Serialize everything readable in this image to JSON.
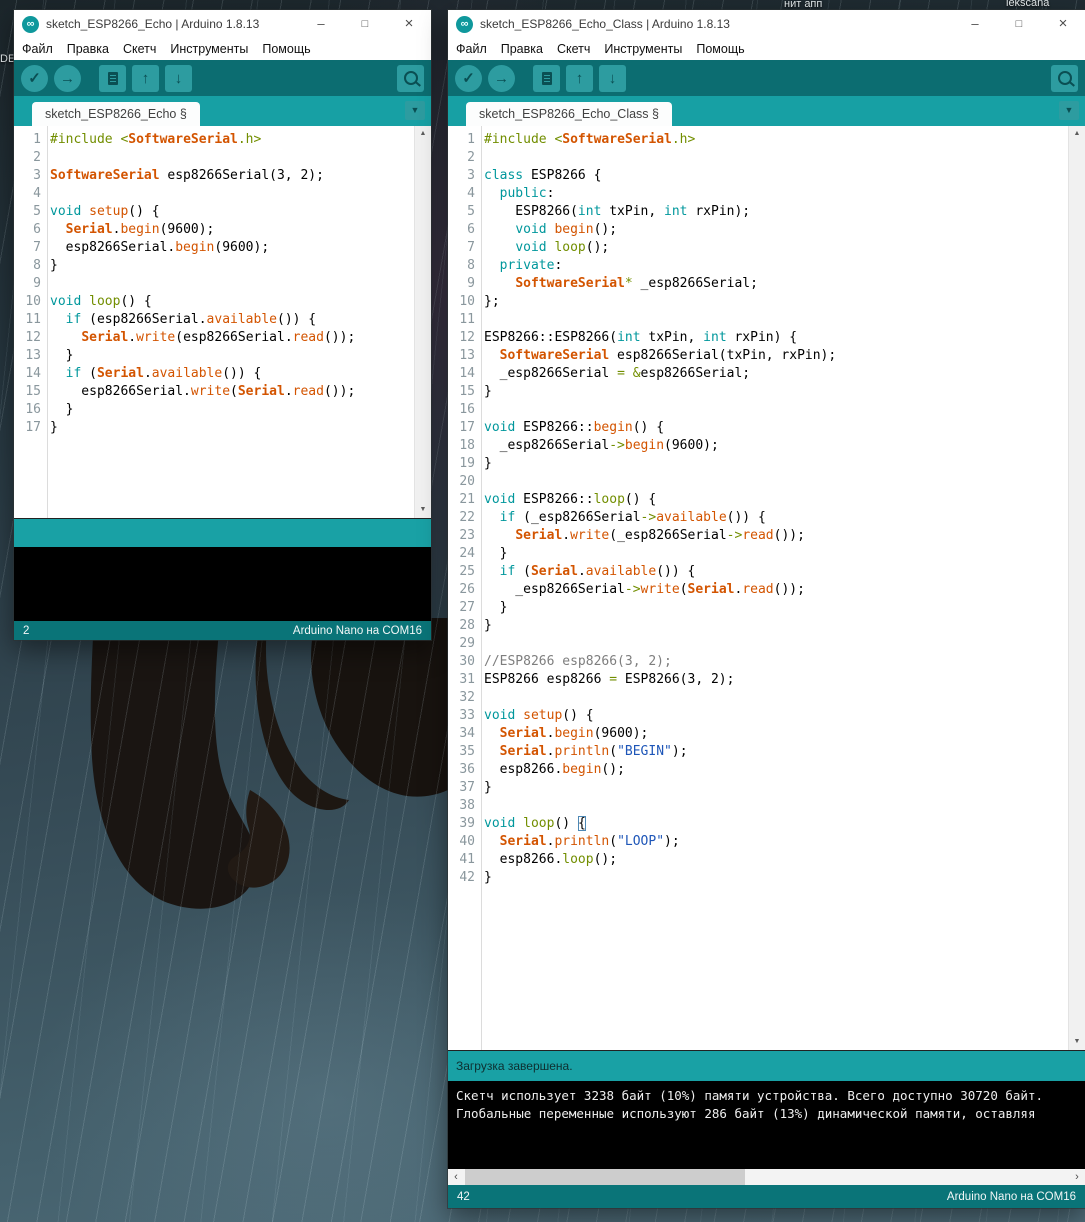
{
  "glyphs": {
    "infinity": "∞",
    "minimize": "–",
    "maximize": "□",
    "close": "×",
    "check": "✓",
    "arrow_right": "→",
    "arrow_up": "↑",
    "arrow_down": "↓",
    "dropdown": "▼",
    "scroll_up": "▲",
    "scroll_down": "▼",
    "scroll_left": "‹",
    "scroll_right": "›"
  },
  "colors": {
    "toolbar_teal": "#0c6d71",
    "tabstrip_teal": "#17a0a4",
    "button_teal": "#2d9ca0",
    "footer_teal": "#0a7478",
    "keyword": "#00979c",
    "function": "#d35400",
    "olive": "#728e00",
    "string": "#1e56b8",
    "comment": "#7e7e7e"
  },
  "desktop": {
    "labels": [
      "DE",
      "нит апп",
      "lekscana"
    ]
  },
  "windows": [
    {
      "title": "sketch_ESP8266_Echo | Arduino 1.8.13",
      "menu": [
        "Файл",
        "Правка",
        "Скетч",
        "Инструменты",
        "Помощь"
      ],
      "tab": "sketch_ESP8266_Echo §",
      "toolbar_icons": [
        "verify",
        "upload",
        "new-sketch",
        "open",
        "save",
        "serial-monitor"
      ],
      "status_message": "",
      "console_lines": [],
      "footer": {
        "line": "2",
        "board": "Arduino Nano на COM16"
      },
      "code": [
        {
          "n": 1,
          "t": [
            [
              "#include ",
              "d"
            ],
            [
              "<",
              "d"
            ],
            [
              "SoftwareSerial",
              "t"
            ],
            [
              ".h>",
              "d"
            ]
          ]
        },
        {
          "n": 2,
          "t": []
        },
        {
          "n": 3,
          "t": [
            [
              "SoftwareSerial",
              "t"
            ],
            [
              " esp8266Serial(3, 2);",
              "p"
            ]
          ]
        },
        {
          "n": 4,
          "t": []
        },
        {
          "n": 5,
          "t": [
            [
              "void",
              "k"
            ],
            [
              " ",
              "p"
            ],
            [
              "setup",
              "f"
            ],
            [
              "() {",
              "p"
            ]
          ]
        },
        {
          "n": 6,
          "t": [
            [
              "  ",
              "p"
            ],
            [
              "Serial",
              "t"
            ],
            [
              ".",
              "p"
            ],
            [
              "begin",
              "f"
            ],
            [
              "(9600);",
              "p"
            ]
          ]
        },
        {
          "n": 7,
          "t": [
            [
              "  esp8266Serial.",
              "p"
            ],
            [
              "begin",
              "f"
            ],
            [
              "(9600);",
              "p"
            ]
          ]
        },
        {
          "n": 8,
          "t": [
            [
              "}",
              "p"
            ]
          ]
        },
        {
          "n": 9,
          "t": []
        },
        {
          "n": 10,
          "t": [
            [
              "void",
              "k"
            ],
            [
              " ",
              "p"
            ],
            [
              "loop",
              "d"
            ],
            [
              "() {",
              "p"
            ]
          ]
        },
        {
          "n": 11,
          "t": [
            [
              "  ",
              "p"
            ],
            [
              "if",
              "k"
            ],
            [
              " (esp8266Serial.",
              "p"
            ],
            [
              "available",
              "f"
            ],
            [
              "()) {",
              "p"
            ]
          ]
        },
        {
          "n": 12,
          "t": [
            [
              "    ",
              "p"
            ],
            [
              "Serial",
              "t"
            ],
            [
              ".",
              "p"
            ],
            [
              "write",
              "f"
            ],
            [
              "(esp8266Serial.",
              "p"
            ],
            [
              "read",
              "f"
            ],
            [
              "());",
              "p"
            ]
          ]
        },
        {
          "n": 13,
          "t": [
            [
              "  }",
              "p"
            ]
          ]
        },
        {
          "n": 14,
          "t": [
            [
              "  ",
              "p"
            ],
            [
              "if",
              "k"
            ],
            [
              " (",
              "p"
            ],
            [
              "Serial",
              "t"
            ],
            [
              ".",
              "p"
            ],
            [
              "available",
              "f"
            ],
            [
              "()) {",
              "p"
            ]
          ]
        },
        {
          "n": 15,
          "t": [
            [
              "    esp8266Serial.",
              "p"
            ],
            [
              "write",
              "f"
            ],
            [
              "(",
              "p"
            ],
            [
              "Serial",
              "t"
            ],
            [
              ".",
              "p"
            ],
            [
              "read",
              "f"
            ],
            [
              "());",
              "p"
            ]
          ]
        },
        {
          "n": 16,
          "t": [
            [
              "  }",
              "p"
            ]
          ]
        },
        {
          "n": 17,
          "t": [
            [
              "}",
              "p"
            ]
          ]
        }
      ]
    },
    {
      "title": "sketch_ESP8266_Echo_Class | Arduino 1.8.13",
      "menu": [
        "Файл",
        "Правка",
        "Скетч",
        "Инструменты",
        "Помощь"
      ],
      "tab": "sketch_ESP8266_Echo_Class §",
      "toolbar_icons": [
        "verify",
        "upload",
        "new-sketch",
        "open",
        "save",
        "serial-monitor"
      ],
      "status_message": "Загрузка завершена.",
      "console_lines": [
        "Скетч использует 3238 байт (10%) памяти устройства. Всего доступно 30720 байт.",
        "Глобальные переменные используют 286 байт (13%) динамической памяти, оставляя"
      ],
      "footer": {
        "line": "42",
        "board": "Arduino Nano на COM16"
      },
      "code": [
        {
          "n": 1,
          "t": [
            [
              "#include ",
              "d"
            ],
            [
              "<",
              "d"
            ],
            [
              "SoftwareSerial",
              "t"
            ],
            [
              ".h>",
              "d"
            ]
          ]
        },
        {
          "n": 2,
          "t": []
        },
        {
          "n": 3,
          "t": [
            [
              "class",
              "k"
            ],
            [
              " ESP8266 {",
              "p"
            ]
          ]
        },
        {
          "n": 4,
          "t": [
            [
              "  ",
              "p"
            ],
            [
              "public",
              "k"
            ],
            [
              ":",
              "p"
            ]
          ]
        },
        {
          "n": 5,
          "t": [
            [
              "    ESP8266(",
              "p"
            ],
            [
              "int",
              "k"
            ],
            [
              " txPin, ",
              "p"
            ],
            [
              "int",
              "k"
            ],
            [
              " rxPin);",
              "p"
            ]
          ]
        },
        {
          "n": 6,
          "t": [
            [
              "    ",
              "p"
            ],
            [
              "void",
              "k"
            ],
            [
              " ",
              "p"
            ],
            [
              "begin",
              "f"
            ],
            [
              "();",
              "p"
            ]
          ]
        },
        {
          "n": 7,
          "t": [
            [
              "    ",
              "p"
            ],
            [
              "void",
              "k"
            ],
            [
              " ",
              "p"
            ],
            [
              "loop",
              "d"
            ],
            [
              "();",
              "p"
            ]
          ]
        },
        {
          "n": 8,
          "t": [
            [
              "  ",
              "p"
            ],
            [
              "private",
              "k"
            ],
            [
              ":",
              "p"
            ]
          ]
        },
        {
          "n": 9,
          "t": [
            [
              "    ",
              "p"
            ],
            [
              "SoftwareSerial",
              "t"
            ],
            [
              "*",
              "d"
            ],
            [
              " _esp8266Serial;",
              "p"
            ]
          ]
        },
        {
          "n": 10,
          "t": [
            [
              "};",
              "p"
            ]
          ]
        },
        {
          "n": 11,
          "t": []
        },
        {
          "n": 12,
          "t": [
            [
              "ESP8266::ESP8266(",
              "p"
            ],
            [
              "int",
              "k"
            ],
            [
              " txPin, ",
              "p"
            ],
            [
              "int",
              "k"
            ],
            [
              " rxPin) {",
              "p"
            ]
          ]
        },
        {
          "n": 13,
          "t": [
            [
              "  ",
              "p"
            ],
            [
              "SoftwareSerial",
              "t"
            ],
            [
              " esp8266Serial(txPin, rxPin);",
              "p"
            ]
          ]
        },
        {
          "n": 14,
          "t": [
            [
              "  _esp8266Serial ",
              "p"
            ],
            [
              "= &",
              "d"
            ],
            [
              "esp8266Serial;",
              "p"
            ]
          ]
        },
        {
          "n": 15,
          "t": [
            [
              "}",
              "p"
            ]
          ]
        },
        {
          "n": 16,
          "t": []
        },
        {
          "n": 17,
          "t": [
            [
              "void",
              "k"
            ],
            [
              " ESP8266::",
              "p"
            ],
            [
              "begin",
              "f"
            ],
            [
              "() {",
              "p"
            ]
          ]
        },
        {
          "n": 18,
          "t": [
            [
              "  _esp8266Serial",
              "p"
            ],
            [
              "->",
              "d"
            ],
            [
              "begin",
              "f"
            ],
            [
              "(9600);",
              "p"
            ]
          ]
        },
        {
          "n": 19,
          "t": [
            [
              "}",
              "p"
            ]
          ]
        },
        {
          "n": 20,
          "t": []
        },
        {
          "n": 21,
          "t": [
            [
              "void",
              "k"
            ],
            [
              " ESP8266::",
              "p"
            ],
            [
              "loop",
              "d"
            ],
            [
              "() {",
              "p"
            ]
          ]
        },
        {
          "n": 22,
          "t": [
            [
              "  ",
              "p"
            ],
            [
              "if",
              "k"
            ],
            [
              " (_esp8266Serial",
              "p"
            ],
            [
              "->",
              "d"
            ],
            [
              "available",
              "f"
            ],
            [
              "()) {",
              "p"
            ]
          ]
        },
        {
          "n": 23,
          "t": [
            [
              "    ",
              "p"
            ],
            [
              "Serial",
              "t"
            ],
            [
              ".",
              "p"
            ],
            [
              "write",
              "f"
            ],
            [
              "(_esp8266Serial",
              "p"
            ],
            [
              "->",
              "d"
            ],
            [
              "read",
              "f"
            ],
            [
              "());",
              "p"
            ]
          ]
        },
        {
          "n": 24,
          "t": [
            [
              "  }",
              "p"
            ]
          ]
        },
        {
          "n": 25,
          "t": [
            [
              "  ",
              "p"
            ],
            [
              "if",
              "k"
            ],
            [
              " (",
              "p"
            ],
            [
              "Serial",
              "t"
            ],
            [
              ".",
              "p"
            ],
            [
              "available",
              "f"
            ],
            [
              "()) {",
              "p"
            ]
          ]
        },
        {
          "n": 26,
          "t": [
            [
              "    _esp8266Serial",
              "p"
            ],
            [
              "->",
              "d"
            ],
            [
              "write",
              "f"
            ],
            [
              "(",
              "p"
            ],
            [
              "Serial",
              "t"
            ],
            [
              ".",
              "p"
            ],
            [
              "read",
              "f"
            ],
            [
              "());",
              "p"
            ]
          ]
        },
        {
          "n": 27,
          "t": [
            [
              "  }",
              "p"
            ]
          ]
        },
        {
          "n": 28,
          "t": [
            [
              "}",
              "p"
            ]
          ]
        },
        {
          "n": 29,
          "t": []
        },
        {
          "n": 30,
          "t": [
            [
              "//ESP8266 esp8266(3, 2);",
              "c"
            ]
          ]
        },
        {
          "n": 31,
          "t": [
            [
              "ESP8266 esp8266 ",
              "p"
            ],
            [
              "=",
              "d"
            ],
            [
              " ESP8266(3, 2);",
              "p"
            ]
          ]
        },
        {
          "n": 32,
          "t": []
        },
        {
          "n": 33,
          "t": [
            [
              "void",
              "k"
            ],
            [
              " ",
              "p"
            ],
            [
              "setup",
              "f"
            ],
            [
              "() {",
              "p"
            ]
          ]
        },
        {
          "n": 34,
          "t": [
            [
              "  ",
              "p"
            ],
            [
              "Serial",
              "t"
            ],
            [
              ".",
              "p"
            ],
            [
              "begin",
              "f"
            ],
            [
              "(9600);",
              "p"
            ]
          ]
        },
        {
          "n": 35,
          "t": [
            [
              "  ",
              "p"
            ],
            [
              "Serial",
              "t"
            ],
            [
              ".",
              "p"
            ],
            [
              "println",
              "f"
            ],
            [
              "(",
              "p"
            ],
            [
              "\"BEGIN\"",
              "s"
            ],
            [
              ");",
              "p"
            ]
          ]
        },
        {
          "n": 36,
          "t": [
            [
              "  esp8266.",
              "p"
            ],
            [
              "begin",
              "f"
            ],
            [
              "();",
              "p"
            ]
          ]
        },
        {
          "n": 37,
          "t": [
            [
              "}",
              "p"
            ]
          ]
        },
        {
          "n": 38,
          "t": []
        },
        {
          "n": 39,
          "t": [
            [
              "void",
              "k"
            ],
            [
              " ",
              "p"
            ],
            [
              "loop",
              "d"
            ],
            [
              "() ",
              "p"
            ],
            [
              "{",
              "hb"
            ]
          ]
        },
        {
          "n": 40,
          "t": [
            [
              "  ",
              "p"
            ],
            [
              "Serial",
              "t"
            ],
            [
              ".",
              "p"
            ],
            [
              "println",
              "f"
            ],
            [
              "(",
              "p"
            ],
            [
              "\"LOOP\"",
              "s"
            ],
            [
              ");",
              "p"
            ]
          ]
        },
        {
          "n": 41,
          "t": [
            [
              "  esp8266.",
              "p"
            ],
            [
              "loop",
              "d"
            ],
            [
              "();",
              "p"
            ]
          ]
        },
        {
          "n": 42,
          "t": [
            [
              "}",
              "p"
            ]
          ]
        }
      ]
    }
  ]
}
